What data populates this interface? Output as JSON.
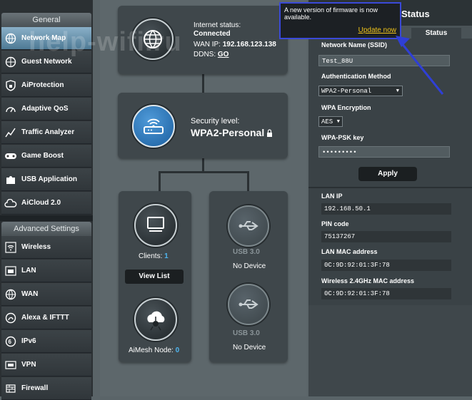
{
  "watermark": "help-wifi.ru",
  "sidebar": {
    "general_title": "General",
    "general_items": [
      {
        "label": "Network Map",
        "icon": "network-map-icon"
      },
      {
        "label": "Guest Network",
        "icon": "guest-network-icon"
      },
      {
        "label": "AiProtection",
        "icon": "shield-icon"
      },
      {
        "label": "Adaptive QoS",
        "icon": "speedometer-icon"
      },
      {
        "label": "Traffic Analyzer",
        "icon": "chart-icon"
      },
      {
        "label": "Game Boost",
        "icon": "gamepad-icon"
      },
      {
        "label": "USB Application",
        "icon": "puzzle-icon"
      },
      {
        "label": "AiCloud 2.0",
        "icon": "cloud-icon"
      }
    ],
    "advanced_title": "Advanced Settings",
    "advanced_items": [
      {
        "label": "Wireless",
        "icon": "wifi-icon"
      },
      {
        "label": "LAN",
        "icon": "lan-icon"
      },
      {
        "label": "WAN",
        "icon": "globe-icon"
      },
      {
        "label": "Alexa & IFTTT",
        "icon": "alexa-icon"
      },
      {
        "label": "IPv6",
        "icon": "ipv6-icon"
      },
      {
        "label": "VPN",
        "icon": "vpn-icon"
      },
      {
        "label": "Firewall",
        "icon": "firewall-icon"
      }
    ]
  },
  "internet": {
    "status_label": "Internet status:",
    "status_value": "Connected",
    "wan_ip_label": "WAN IP:",
    "wan_ip_value": "192.168.123.138",
    "ddns_label": "DDNS:",
    "ddns_link": "GO"
  },
  "router": {
    "security_label": "Security level:",
    "security_value": "WPA2-Personal"
  },
  "clients": {
    "label": "Clients:",
    "count": "1",
    "view_list": "View List"
  },
  "aimesh": {
    "label": "AiMesh Node:",
    "count": "0"
  },
  "usb": [
    {
      "label": "USB 3.0",
      "status": "No Device"
    },
    {
      "label": "USB 3.0",
      "status": "No Device"
    }
  ],
  "popup": {
    "message": "A new version of firmware is now available.",
    "link": "Update now"
  },
  "panel": {
    "title": "Status",
    "tab_status": "Status",
    "ssid_label": "Network Name (SSID)",
    "ssid_value": "Test_88U",
    "auth_label": "Authentication Method",
    "auth_value": "WPA2-Personal",
    "enc_label": "WPA Encryption",
    "enc_value": "AES",
    "psk_label": "WPA-PSK key",
    "psk_value": "•••••••••",
    "apply": "Apply",
    "lan_ip_label": "LAN IP",
    "lan_ip_value": "192.168.50.1",
    "pin_label": "PIN code",
    "pin_value": "75137267",
    "lan_mac_label": "LAN MAC address",
    "lan_mac_value": "0C:9D:92:01:3F:78",
    "wifi_mac_label": "Wireless 2.4GHz MAC address",
    "wifi_mac_value": "0C:9D:92:01:3F:78"
  },
  "colors": {
    "accent_blue": "#2f7fc8",
    "link_yellow": "#f0c419",
    "popup_border": "#3a49d8",
    "arrow": "#2f3fd6"
  }
}
